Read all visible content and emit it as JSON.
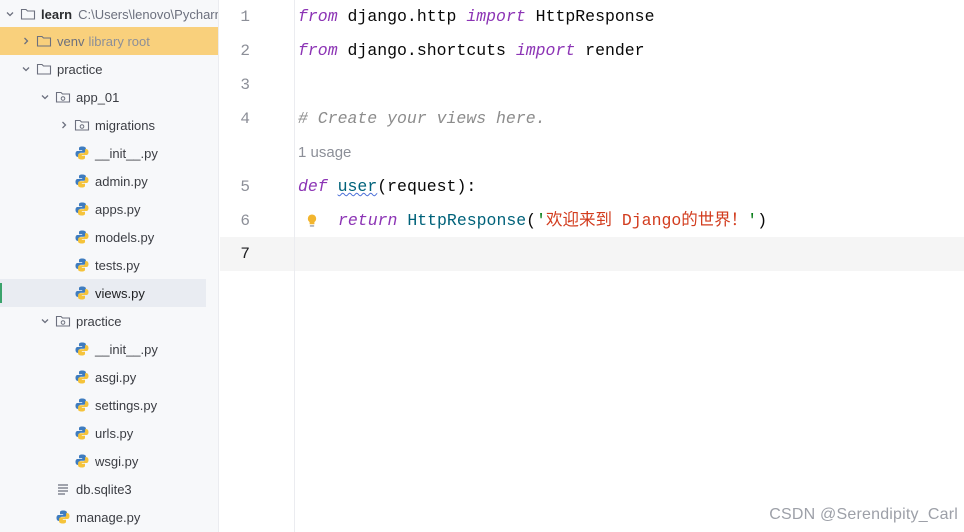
{
  "project_tree": {
    "root": {
      "name": "learn",
      "path": "C:\\Users\\lenovo\\Pycharm"
    },
    "items": [
      {
        "label": "venv",
        "suffix": "library root"
      },
      {
        "label": "practice"
      },
      {
        "label": "app_01"
      },
      {
        "label": "migrations"
      },
      {
        "label": "__init__.py"
      },
      {
        "label": "admin.py"
      },
      {
        "label": "apps.py"
      },
      {
        "label": "models.py"
      },
      {
        "label": "tests.py"
      },
      {
        "label": "views.py"
      },
      {
        "label": "practice"
      },
      {
        "label": "__init__.py"
      },
      {
        "label": "asgi.py"
      },
      {
        "label": "settings.py"
      },
      {
        "label": "urls.py"
      },
      {
        "label": "wsgi.py"
      },
      {
        "label": "db.sqlite3"
      },
      {
        "label": "manage.py"
      }
    ]
  },
  "editor": {
    "line_numbers": [
      "1",
      "2",
      "3",
      "4",
      "5",
      "6",
      "7"
    ],
    "current_line": "7",
    "inlay_hint": "1 usage",
    "tokens": {
      "l1_from": "from",
      "l1_mod": " django.http ",
      "l1_import": "import",
      "l1_name": " HttpResponse",
      "l2_from": "from",
      "l2_mod": " django.shortcuts ",
      "l2_import": "import",
      "l2_name": " render",
      "l4_comment": "# Create your views here.",
      "l5_def": "def",
      "l5_sp": " ",
      "l5_fn": "user",
      "l5_rest": "(request):",
      "l6_return": "return",
      "l6_sp": " ",
      "l6_call": "HttpResponse",
      "l6_open": "(",
      "l6_q1": "'",
      "l6_str": "欢迎来到 Django的世界！",
      "l6_q2": "'",
      "l6_close": ")"
    }
  },
  "watermark": "CSDN @Serendipity_Carl",
  "colors": {
    "highlight": "#f9d07c",
    "keyword_italic": "#8c34b5",
    "function": "#00627a",
    "comment": "#8c8c8c",
    "string": "#d23c1e"
  }
}
